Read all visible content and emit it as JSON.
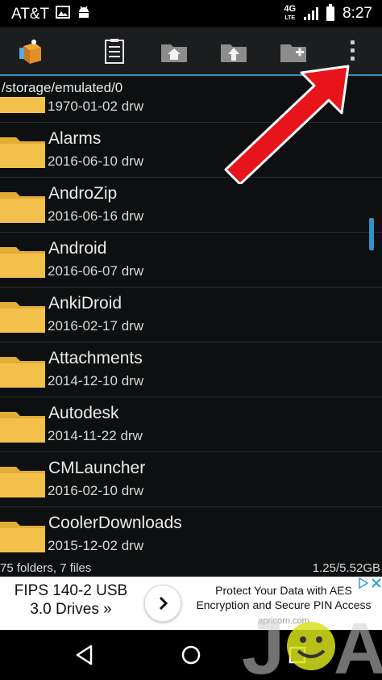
{
  "status_bar": {
    "carrier": "AT&T",
    "network": "4G",
    "network_sub": "LTE",
    "time": "8:27"
  },
  "toolbar": {
    "buttons": [
      "app-logo",
      "select-items",
      "home-folder",
      "up-folder",
      "new-folder",
      "overflow-menu"
    ]
  },
  "path": "/storage/emulated/0",
  "entries": [
    {
      "name": "",
      "date": "1970-01-02",
      "perms": "drw"
    },
    {
      "name": "Alarms",
      "date": "2016-06-10",
      "perms": "drw"
    },
    {
      "name": "AndroZip",
      "date": "2016-06-16",
      "perms": "drw"
    },
    {
      "name": "Android",
      "date": "2016-06-07",
      "perms": "drw"
    },
    {
      "name": "AnkiDroid",
      "date": "2016-02-17",
      "perms": "drw"
    },
    {
      "name": "Attachments",
      "date": "2014-12-10",
      "perms": "drw"
    },
    {
      "name": "Autodesk",
      "date": "2014-11-22",
      "perms": "drw"
    },
    {
      "name": "CMLauncher",
      "date": "2016-02-10",
      "perms": "drw"
    },
    {
      "name": "CoolerDownloads",
      "date": "2015-12-02",
      "perms": "drw"
    }
  ],
  "summary": {
    "counts": "75 folders, 7 files",
    "storage": "1.25/5.52GB"
  },
  "ad": {
    "left_line1": "FIPS 140-2 USB",
    "left_line2": "3.0 Drives »",
    "right_line1": "Protect Your Data with AES",
    "right_line2": "Encryption and Secure PIN Access",
    "watermark_text": "apricorn.com"
  },
  "colors": {
    "accent": "#2e93c8",
    "folder": "#f3c14b",
    "annotation_arrow": "#e8141b"
  }
}
